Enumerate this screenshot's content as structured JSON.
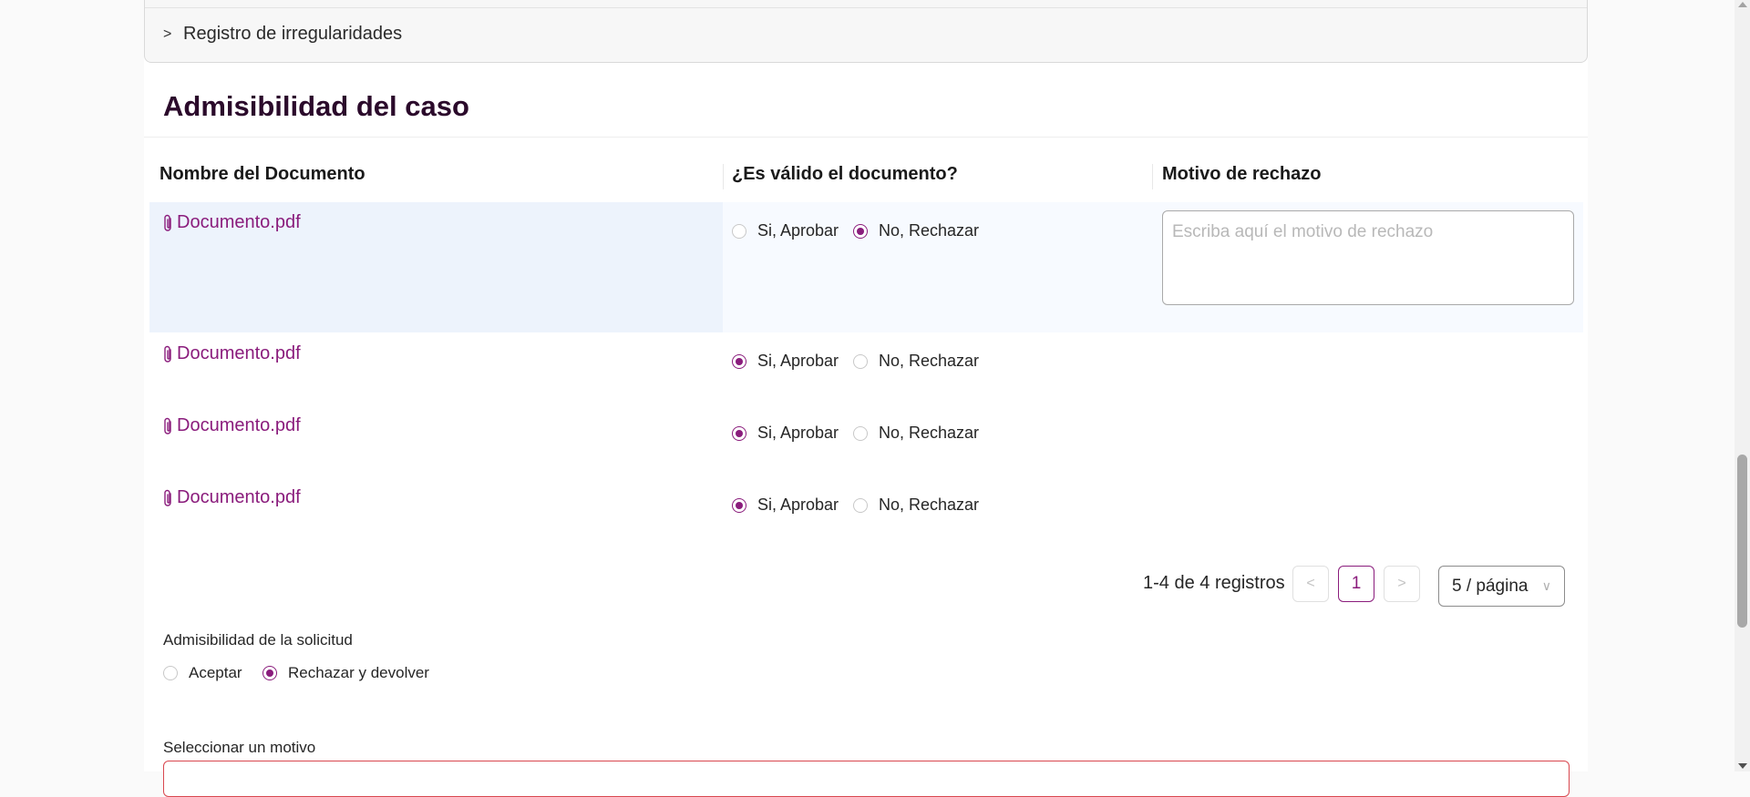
{
  "collapse": {
    "label": "Registro de irregularidades"
  },
  "section": {
    "title": "Admisibilidad del caso"
  },
  "table": {
    "headers": [
      "Nombre del Documento",
      "¿Es válido el documento?",
      "Motivo de rechazo"
    ],
    "option_approve": "Si, Aprobar",
    "option_reject": "No, Rechazar",
    "reason_placeholder": "Escriba aquí el motivo de rechazo",
    "rows": [
      {
        "document": "Documento.pdf",
        "status": "rechazar"
      },
      {
        "document": "Documento.pdf",
        "status": "aprobar"
      },
      {
        "document": "Documento.pdf",
        "status": "aprobar"
      },
      {
        "document": "Documento.pdf",
        "status": "aprobar"
      }
    ]
  },
  "pagination": {
    "total_text": "1-4 de 4 registros",
    "current_page": "1",
    "page_size": "5 / página"
  },
  "admissibility": {
    "label": "Admisibilidad de la solicitud",
    "option_accept": "Aceptar",
    "option_reject": "Rechazar y devolver",
    "selected": "Rechazar y devolver"
  },
  "motive": {
    "label": "Seleccionar un motivo"
  },
  "colors": {
    "accent": "#8a1c7c",
    "title": "#2b0a2b",
    "error_border": "#d9474f",
    "selected_row": "#edf3fc"
  },
  "icons": {
    "document": "paperclip-icon",
    "expand": "chevron-right-icon"
  }
}
